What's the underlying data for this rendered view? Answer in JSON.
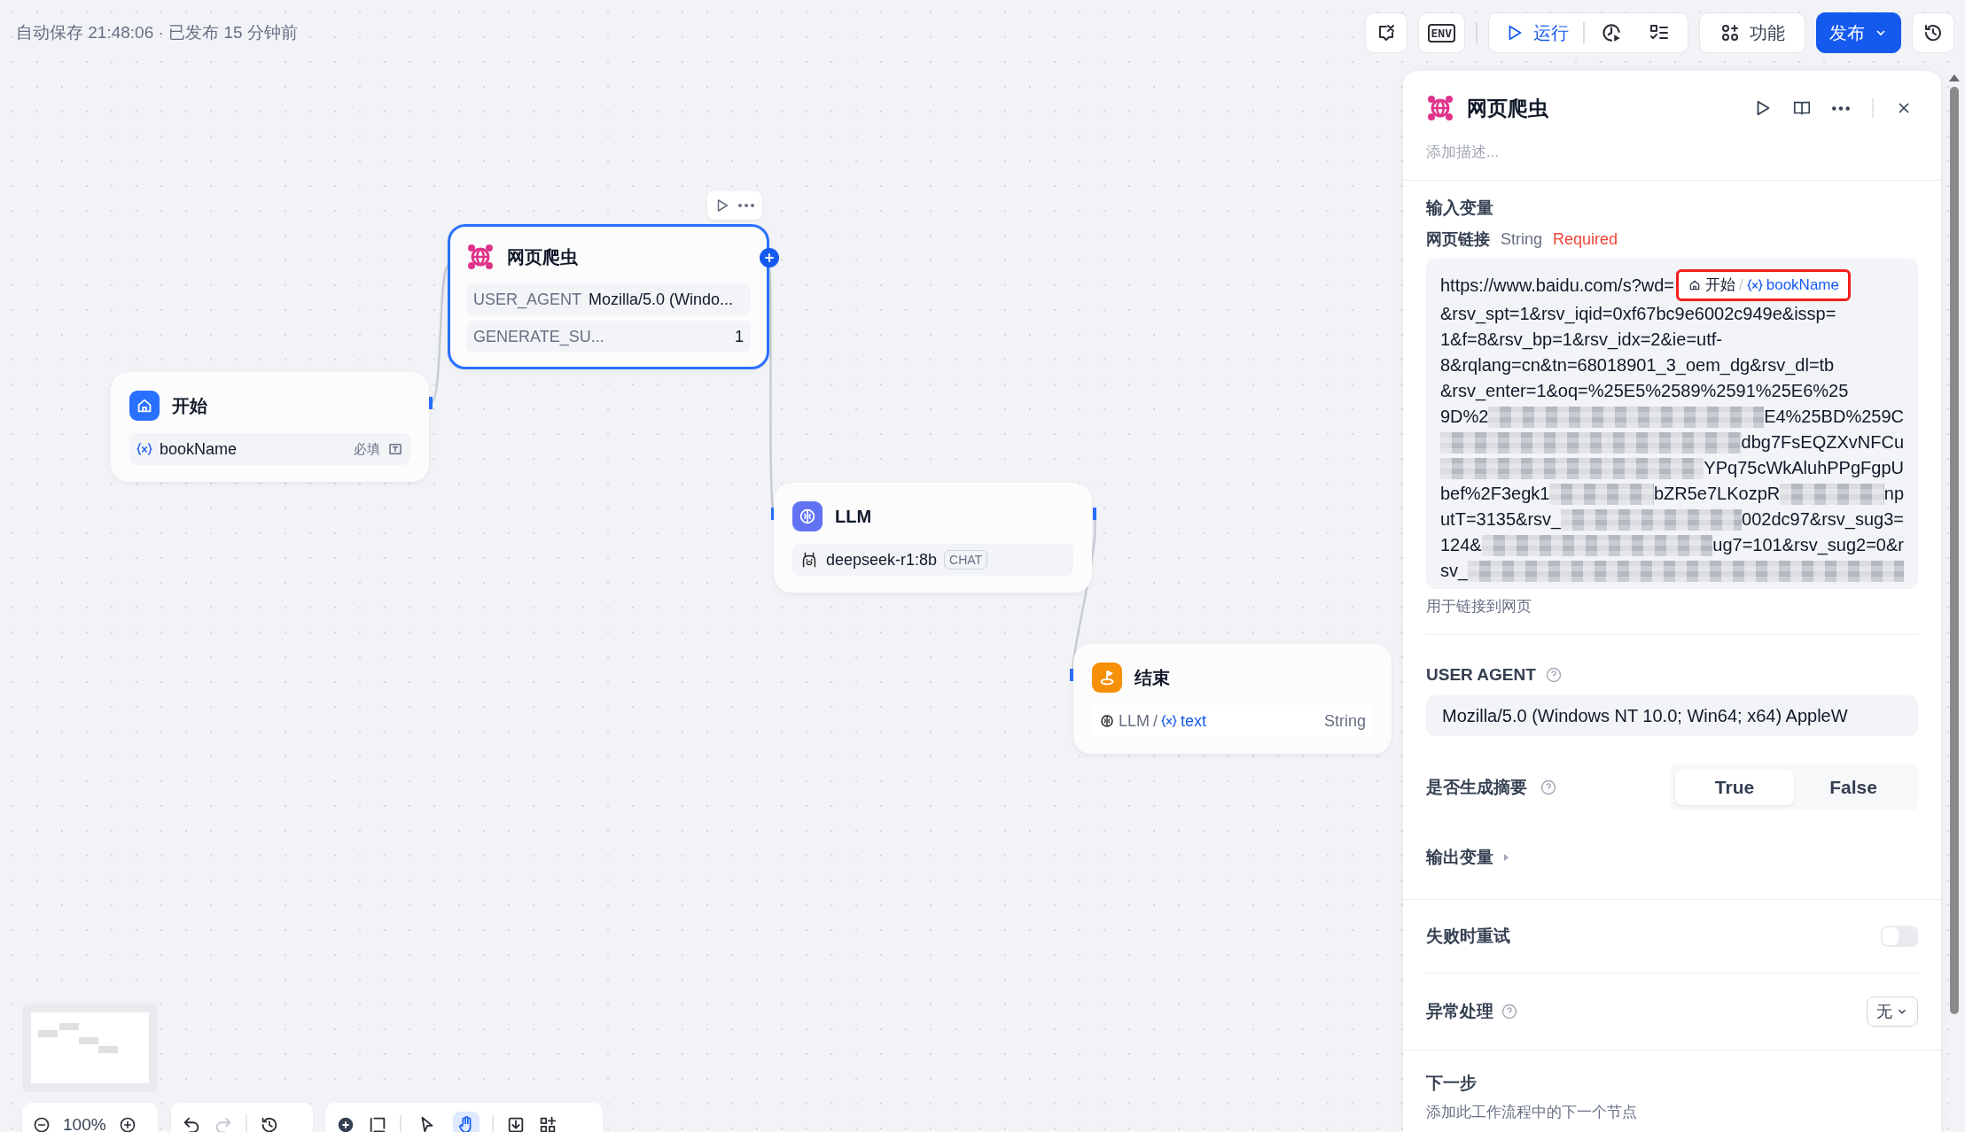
{
  "status": "自动保存 21:48:06 · 已发布 15 分钟前",
  "toolbar": {
    "env": "ENV",
    "run": "运行",
    "features": "功能",
    "publish": "发布"
  },
  "nodes": [
    {
      "kind": "start",
      "title": "开始",
      "selected": false,
      "var": "bookName",
      "required": "必填"
    },
    {
      "kind": "crawler",
      "title": "网页爬虫",
      "selected": true,
      "rows": [
        {
          "name": "USER_AGENT",
          "value": "Mozilla/5.0 (Windo..."
        },
        {
          "name": "GENERATE_SU...",
          "value": "1"
        }
      ]
    },
    {
      "kind": "llm",
      "title": "LLM",
      "selected": false,
      "model": "deepseek-r1:8b",
      "tag": "CHAT"
    },
    {
      "kind": "end",
      "title": "结束",
      "selected": false,
      "source": "LLM",
      "separator": "/",
      "var": "text",
      "type": "String"
    }
  ],
  "zoom": "100%",
  "pointer_modes": [
    {
      "selected": false
    },
    {
      "selected": true
    }
  ],
  "panel": {
    "title": "网页爬虫",
    "description_placeholder": "添加描述...",
    "input_section": "输入变量",
    "url_field": {
      "label": "网页链接",
      "type": "String",
      "required": "Required",
      "ref": {
        "node": "开始",
        "separator": "/",
        "var": "bookName",
        "highlighted": true
      },
      "lines": [
        [
          {
            "kind": "text",
            "text": "https://www.baidu.com/s?wd="
          },
          {
            "kind": "ref"
          }
        ],
        [
          {
            "kind": "text",
            "text": "&rsv_spt=1&rsv_iqid=0xf67bc9e6002c949e&issp="
          }
        ],
        [
          {
            "kind": "text",
            "text": "1&f=8&rsv_bp=1&rsv_idx=2&ie=utf-"
          }
        ],
        [
          {
            "kind": "text",
            "text": "8&rqlang=cn&tn=68018901_3_oem_dg&rsv_dl=tb"
          }
        ],
        [
          {
            "kind": "text",
            "text": "&rsv_enter=1&oq=%25E5%2589%2591%25E6%25"
          }
        ],
        [
          {
            "kind": "text",
            "text": "9D%2"
          },
          {
            "kind": "blur"
          },
          {
            "kind": "text",
            "text": "E4%25BD%259C"
          }
        ],
        [
          {
            "kind": "blur"
          },
          {
            "kind": "text",
            "text": "dbg7FsEQZXvNFCu"
          }
        ],
        [
          {
            "kind": "blur"
          },
          {
            "kind": "text",
            "text": "YPq75cWkAluhPPgFgpU"
          }
        ],
        [
          {
            "kind": "text",
            "text": "bef%2F3egk1"
          },
          {
            "kind": "blur"
          },
          {
            "kind": "text",
            "text": "bZR5e7LKozpR"
          },
          {
            "kind": "blur"
          },
          {
            "kind": "text",
            "text": "np"
          }
        ],
        [
          {
            "kind": "text",
            "text": "utT=3135&rsv_"
          },
          {
            "kind": "blur"
          },
          {
            "kind": "text",
            "text": "002dc97&rsv_sug3="
          }
        ],
        [
          {
            "kind": "text",
            "text": "124&"
          },
          {
            "kind": "blur"
          },
          {
            "kind": "text",
            "text": "ug7=101&rsv_sug2=0&r"
          }
        ],
        [
          {
            "kind": "text",
            "text": "sv_"
          },
          {
            "kind": "blur"
          }
        ]
      ],
      "help": "用于链接到网页"
    },
    "user_agent": {
      "label": "USER AGENT",
      "value": "Mozilla/5.0 (Windows NT 10.0; Win64; x64) AppleW"
    },
    "summary": {
      "label": "是否生成摘要",
      "options": [
        {
          "label": "True",
          "selected": true
        },
        {
          "label": "False",
          "selected": false
        }
      ]
    },
    "output_section": {
      "label": "输出变量",
      "expanded": false
    },
    "retry": {
      "label": "失败时重试",
      "on": false
    },
    "error": {
      "label": "异常处理",
      "value": "无"
    },
    "next": {
      "title": "下一步",
      "description": "添加此工作流程中的下一个节点"
    }
  }
}
